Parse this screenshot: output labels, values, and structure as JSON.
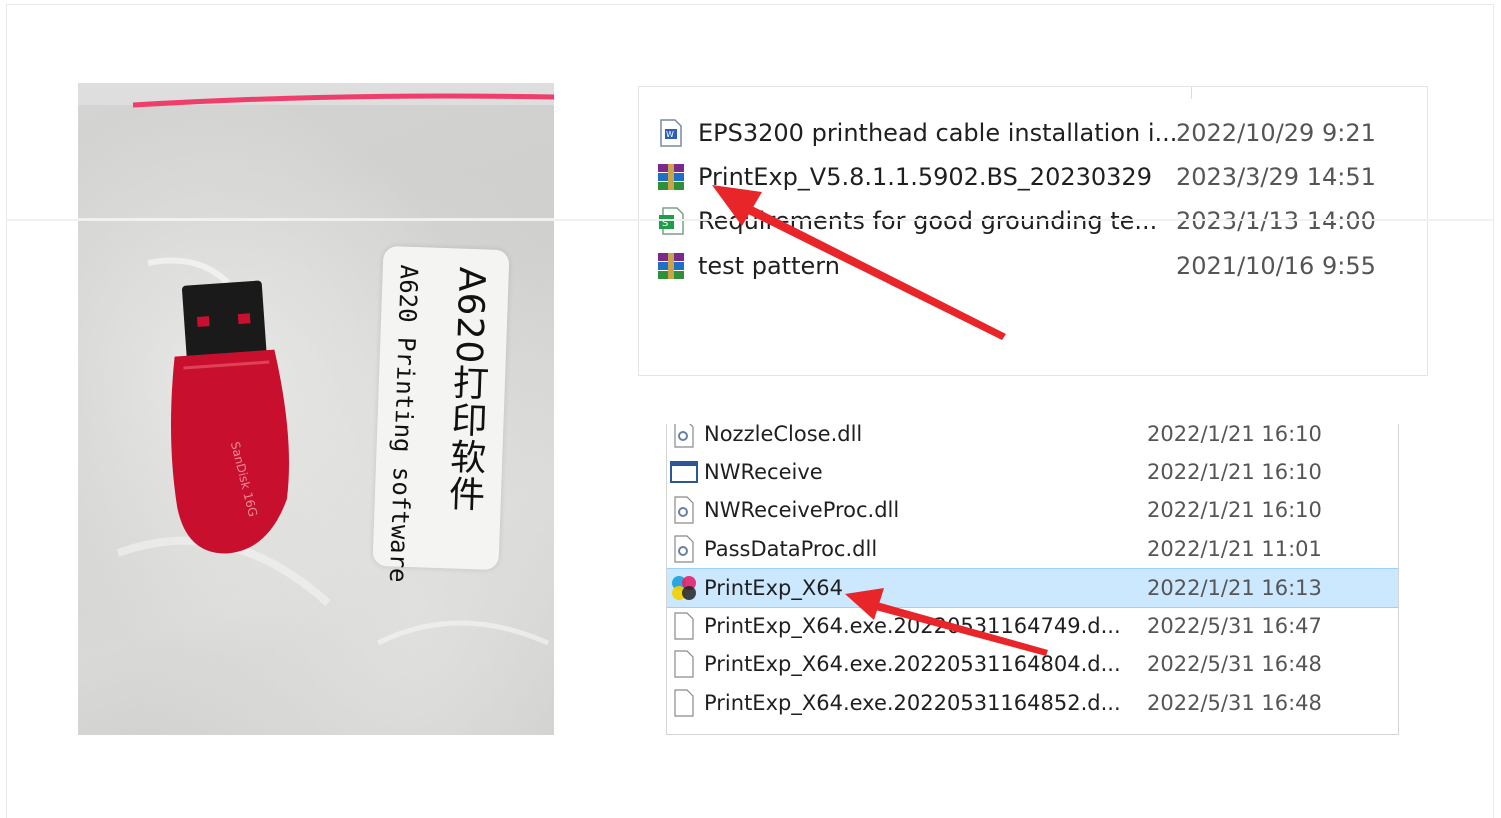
{
  "usb_photo": {
    "label_chinese": "A620打印软件",
    "label_english": "A620 Printing software"
  },
  "top_listing": {
    "files": [
      {
        "name": "EPS3200 printhead cable installation i...",
        "date": "2022/10/29 9:21",
        "icon": "document-icon"
      },
      {
        "name": "PrintExp_V5.8.1.1.5902.BS_20230329",
        "date": "2023/3/29 14:51",
        "icon": "winrar-archive-icon"
      },
      {
        "name": "Requirements for good grounding te...",
        "date": "2023/1/13 14:00",
        "icon": "spreadsheet-icon"
      },
      {
        "name": "test pattern",
        "date": "2021/10/16 9:55",
        "icon": "winrar-archive-icon"
      }
    ]
  },
  "bottom_listing": {
    "files": [
      {
        "name": "NozzleClose.dll",
        "date": "2022/1/21 16:10",
        "icon": "dll-file-icon"
      },
      {
        "name": "NWReceive",
        "date": "2022/1/21 16:10",
        "icon": "window-app-icon"
      },
      {
        "name": "NWReceiveProc.dll",
        "date": "2022/1/21 16:10",
        "icon": "dll-file-icon"
      },
      {
        "name": "PassDataProc.dll",
        "date": "2022/1/21 11:01",
        "icon": "dll-file-icon"
      },
      {
        "name": "PrintExp_X64",
        "date": "2022/1/21 16:13",
        "icon": "printexp-app-icon",
        "selected": true
      },
      {
        "name": "PrintExp_X64.exe.20220531164749.d...",
        "date": "2022/5/31 16:47",
        "icon": "blank-file-icon"
      },
      {
        "name": "PrintExp_X64.exe.20220531164804.d...",
        "date": "2022/5/31 16:48",
        "icon": "blank-file-icon"
      },
      {
        "name": "PrintExp_X64.exe.20220531164852.d...",
        "date": "2022/5/31 16:48",
        "icon": "blank-file-icon"
      }
    ]
  },
  "colors": {
    "selection": "#cce8ff",
    "arrow": "#e8262a",
    "usb_body": "#c8102e"
  }
}
